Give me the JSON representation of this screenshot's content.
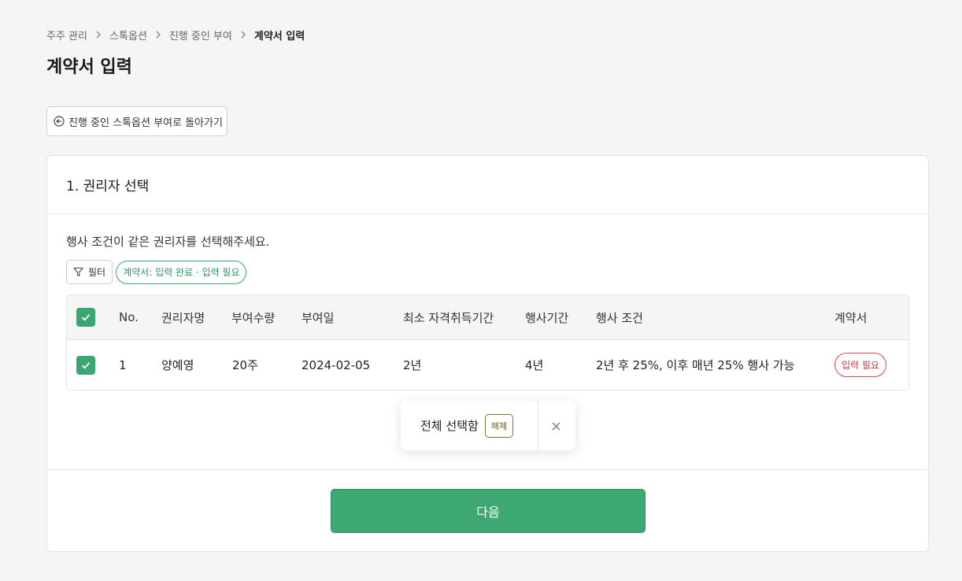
{
  "breadcrumb": {
    "items": [
      "주주 관리",
      "스톡옵션",
      "진행 중인 부여",
      "계약서 입력"
    ]
  },
  "page": {
    "title": "계약서 입력"
  },
  "back_button": {
    "label": "진행 중인 스톡옵션 부여로 돌아가기",
    "icon": "arrow-left-circle-icon"
  },
  "section": {
    "title": "1. 권리자 선택",
    "instruction": "행사 조건이 같은 권리자를 선택해주세요."
  },
  "filter": {
    "button_label": "필터",
    "chip_label": "계약서: 입력 완료 · 입력 필요"
  },
  "table": {
    "headers": [
      "No.",
      "권리자명",
      "부여수량",
      "부여일",
      "최소 자격취득기간",
      "행사기간",
      "행사 조건",
      "계약서"
    ],
    "header_checked": true,
    "rows": [
      {
        "checked": true,
        "no": "1",
        "name": "양예영",
        "quantity": "20주",
        "grant_date": "2024-02-05",
        "vesting_min": "2년",
        "exercise_period": "4년",
        "condition": "2년 후 25%, 이후 매년 25% 행사 가능",
        "contract_status": "입력 필요"
      }
    ]
  },
  "selection_popup": {
    "label": "전체 선택함",
    "release_label": "해제"
  },
  "next_button": {
    "label": "다음"
  },
  "colors": {
    "accent_green": "#3ea872",
    "warning_red": "#d84a4a",
    "release_brown": "#8a7230"
  }
}
